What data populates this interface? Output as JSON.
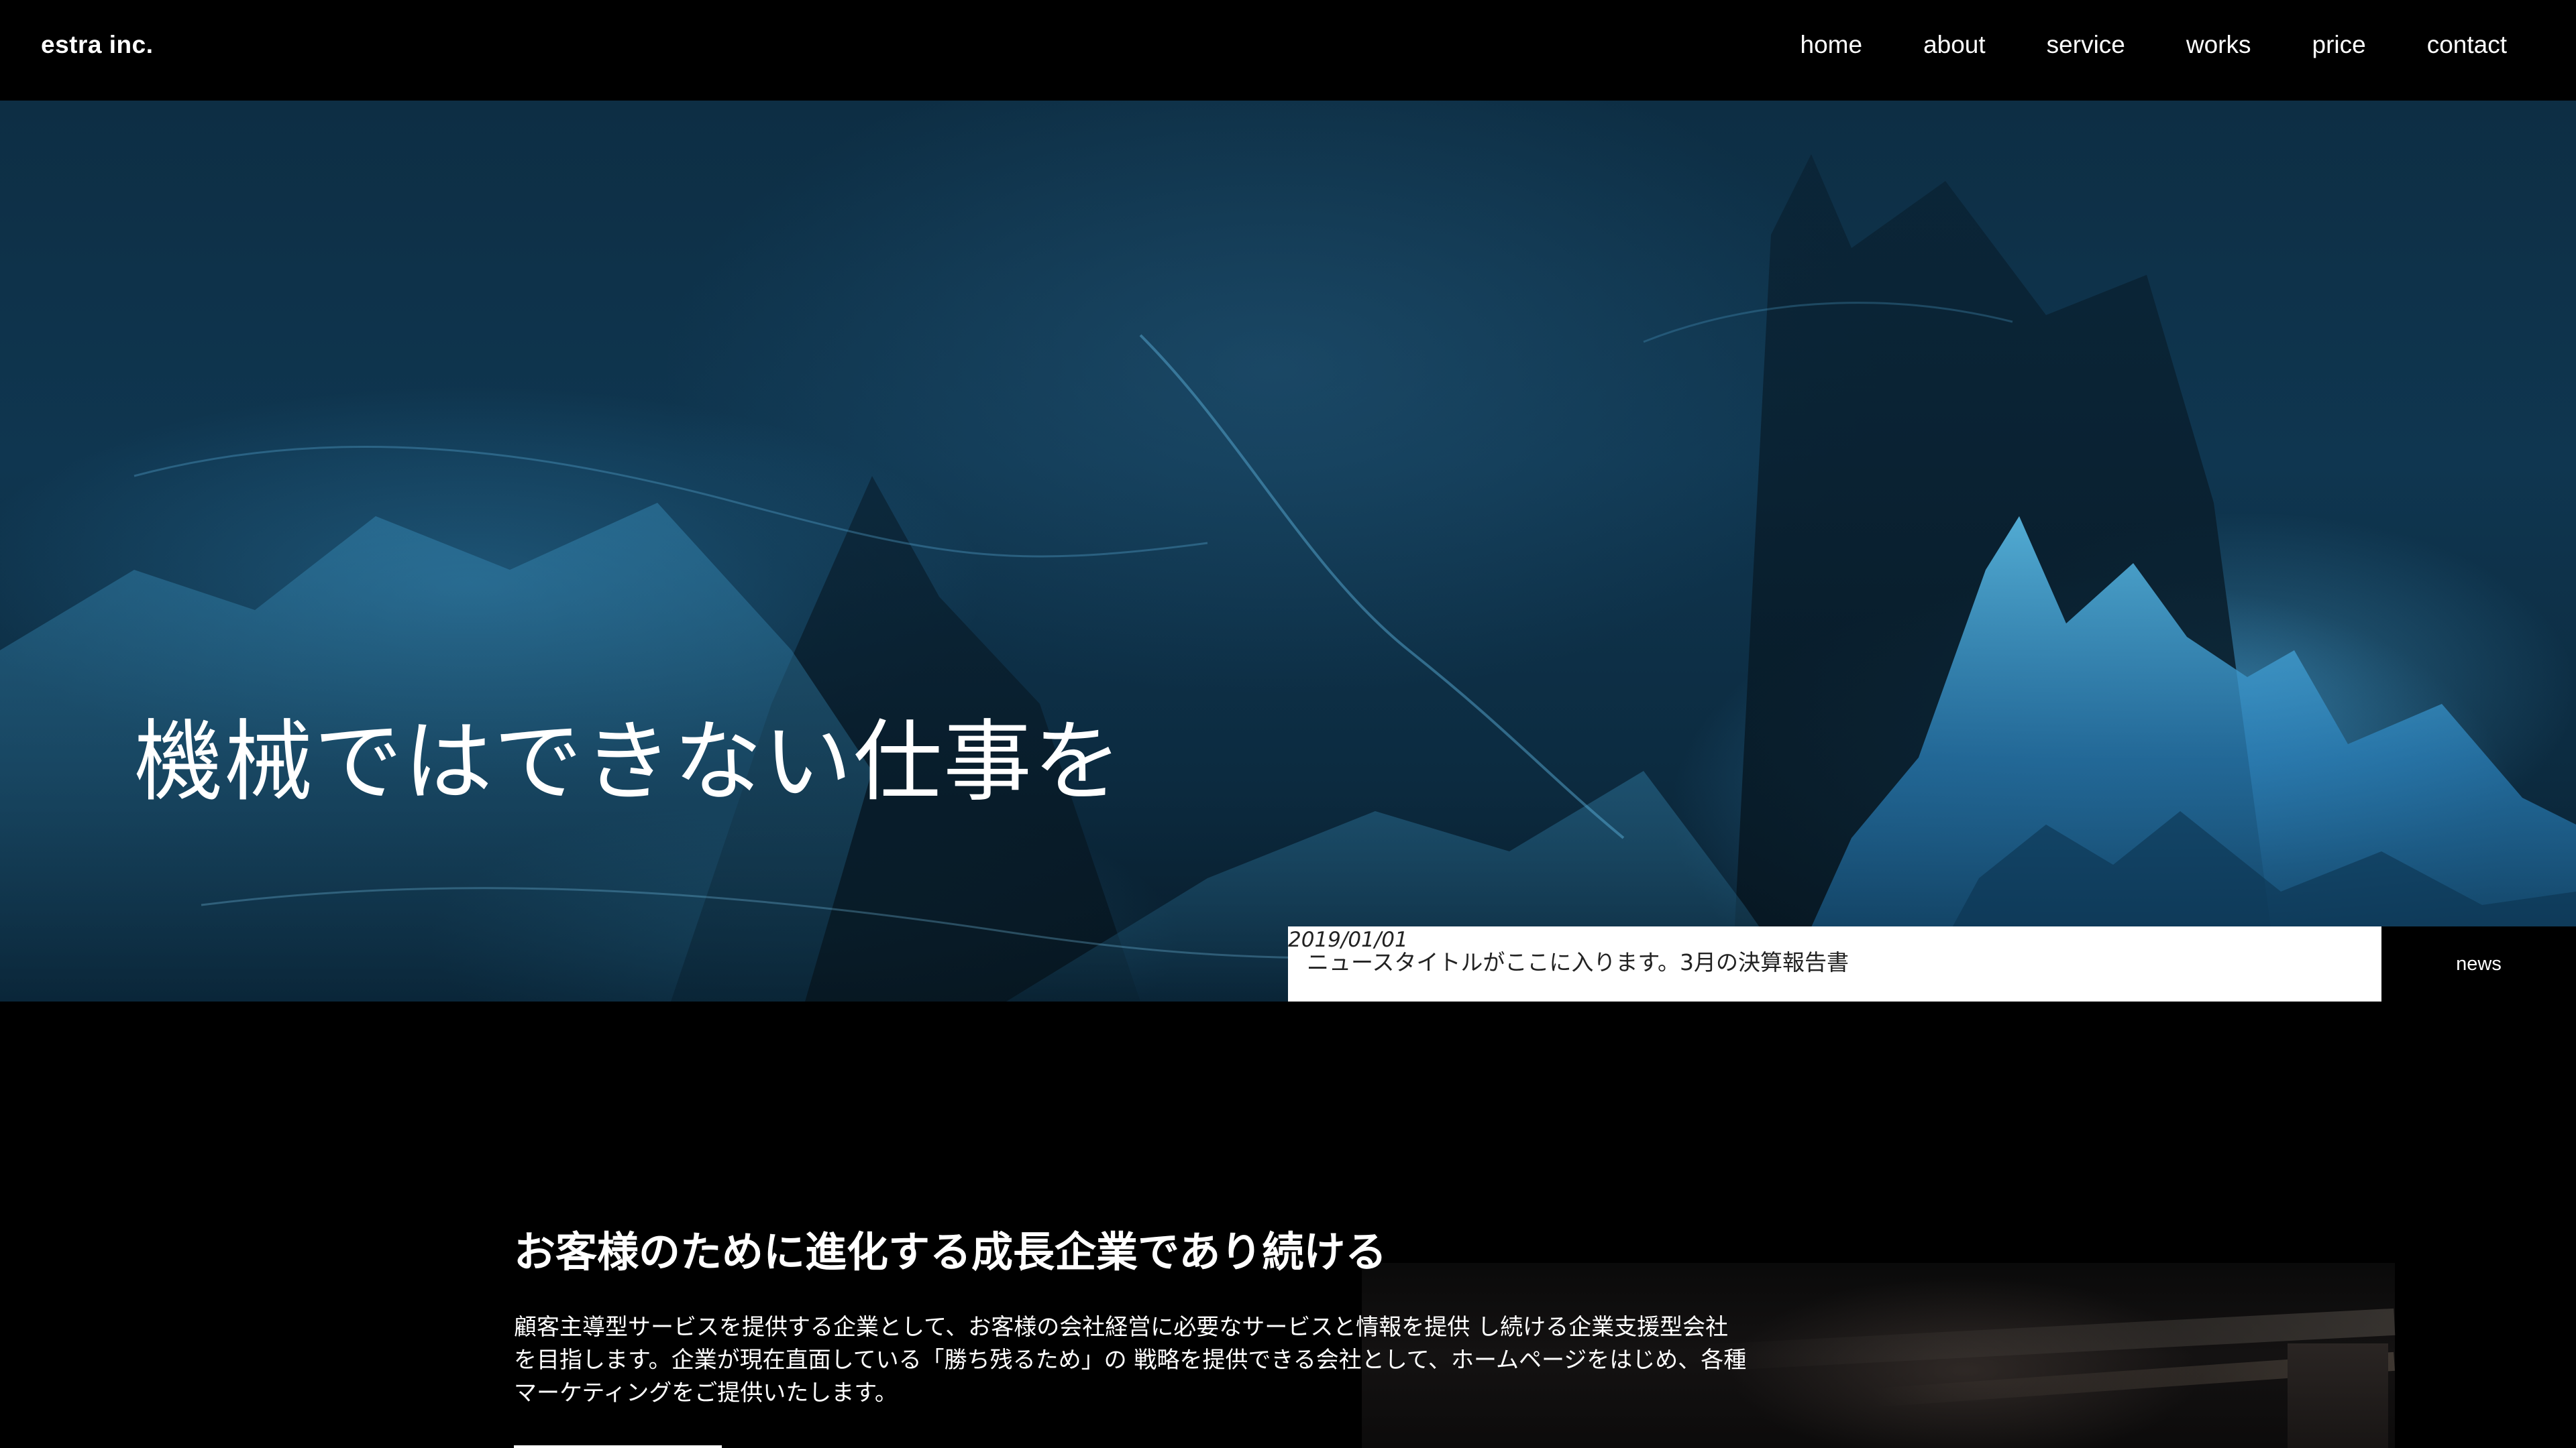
{
  "header": {
    "logo": "estra inc.",
    "nav": [
      "home",
      "about",
      "service",
      "works",
      "price",
      "contact"
    ]
  },
  "hero": {
    "title": "機械ではできない仕事を"
  },
  "news": {
    "date": "2019/01/01",
    "title": "ニュースタイトルがここに入ります。3月の決算報告書",
    "label": "news"
  },
  "about": {
    "heading": "お客様のために進化する成長企業であり続ける",
    "body": "顧客主導型サービスを提供する企業として、お客様の会社経営に必要なサービスと情報を提供 し続ける企業支援型会社を目指します。企業が現在直面している「勝ち残るため」の 戦略を提供できる会社として、ホームページをはじめ、各種マーケティングをご提供いたします。"
  },
  "colors": {
    "background": "#000000",
    "text": "#ffffff",
    "hero_base": "#0f3650",
    "hero_highlight": "#48aae6"
  }
}
